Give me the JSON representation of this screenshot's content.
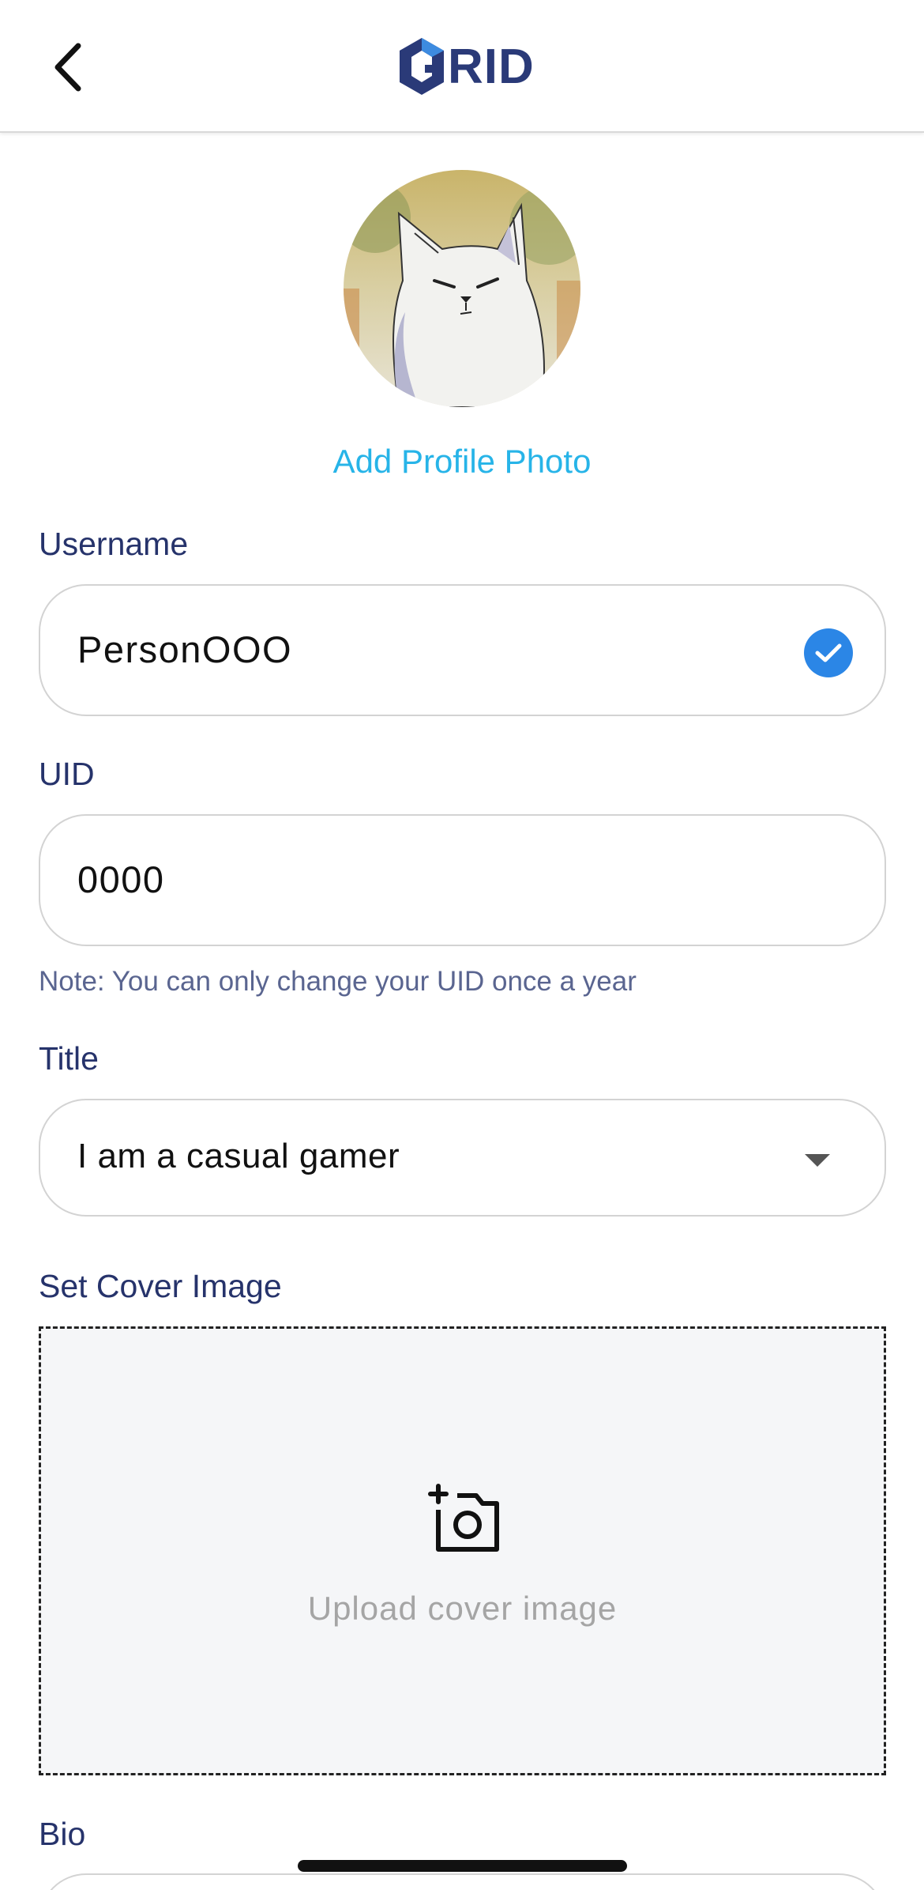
{
  "header": {
    "back_icon": "chevron-left-icon",
    "logo_text": "RID",
    "logo_mark": "G-hexagon-logo",
    "brand_color": "#2a3a78",
    "brand_accent": "#3d8be0"
  },
  "profile": {
    "avatar_icon": "cat-avatar",
    "add_photo_label": "Add Profile Photo",
    "link_color": "#27b4e8"
  },
  "username": {
    "label": "Username",
    "value": "PersonOOO",
    "status_icon": "check-circle-icon",
    "status_color": "#2b86e6"
  },
  "uid": {
    "label": "UID",
    "value": "0000",
    "note": "Note: You can only change your UID once a year"
  },
  "title": {
    "label": "Title",
    "selected": "I am a casual gamer",
    "arrow_icon": "caret-down-icon"
  },
  "cover": {
    "label": "Set Cover Image",
    "upload_text": "Upload cover image",
    "icon": "add-camera-icon"
  },
  "bio": {
    "label": "Bio"
  }
}
